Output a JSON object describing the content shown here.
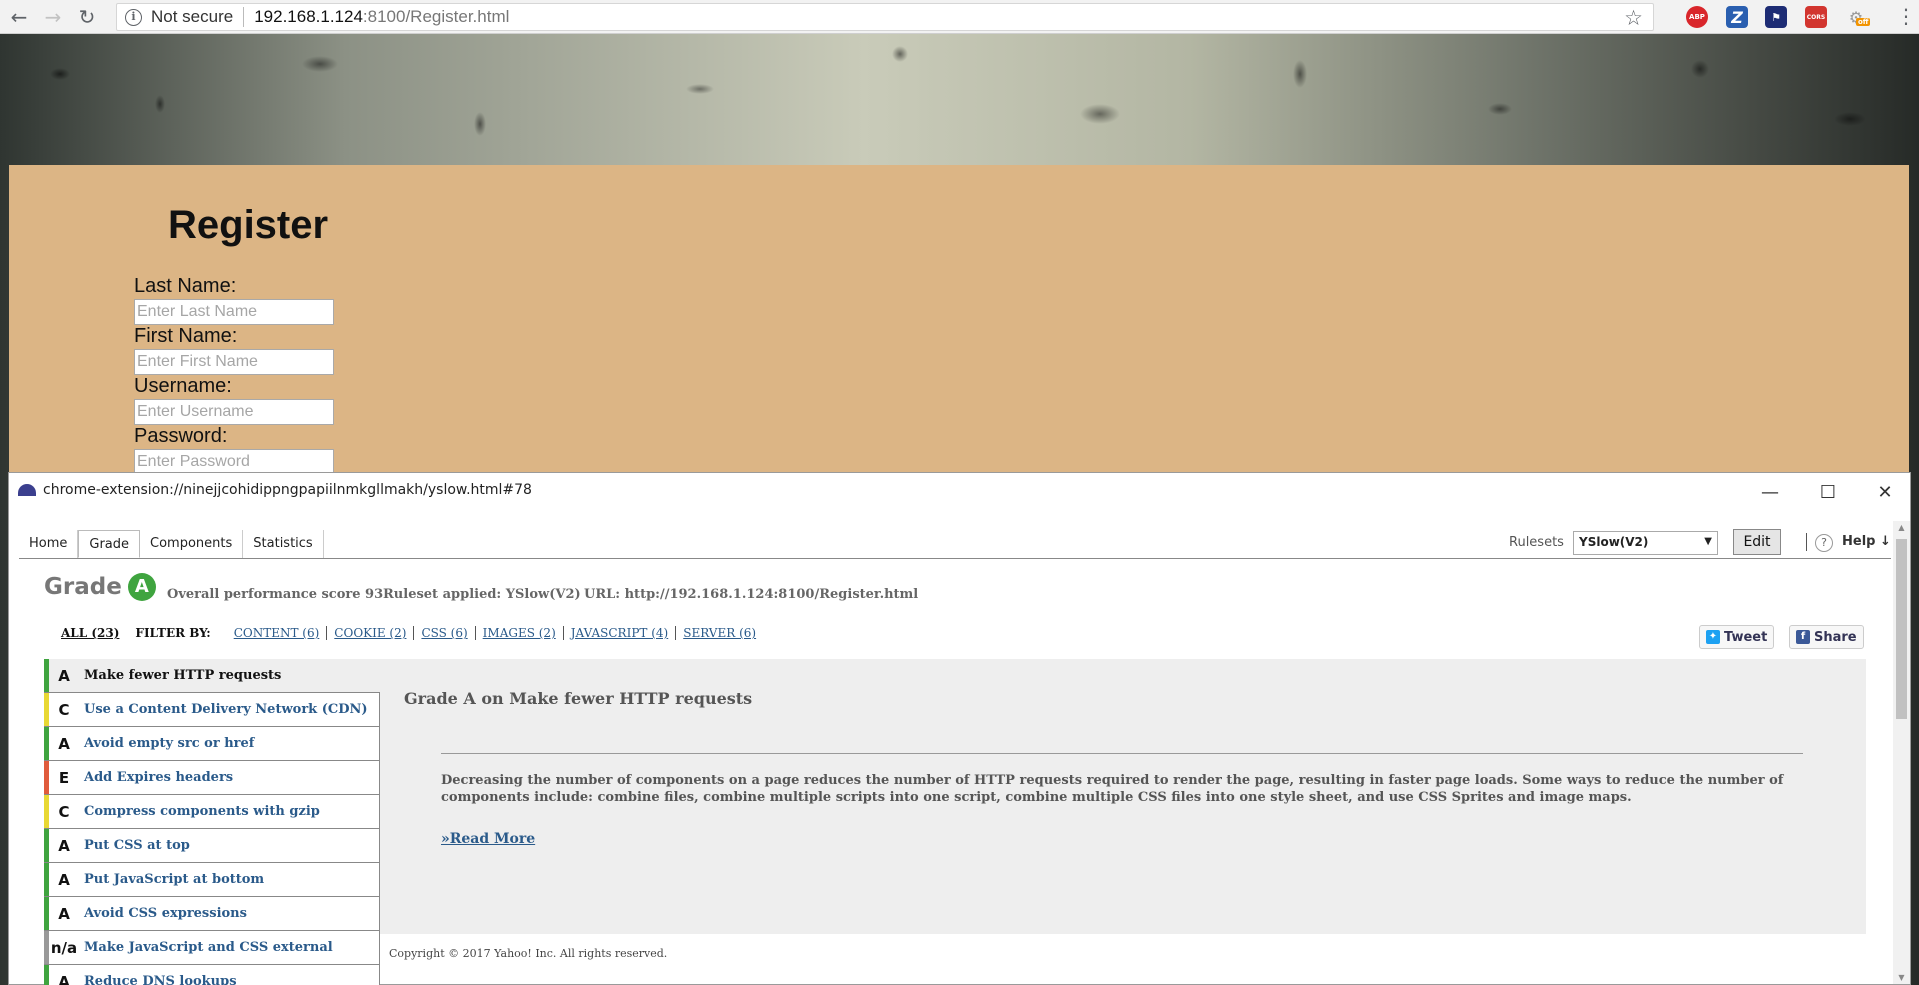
{
  "browser": {
    "security_label": "Not secure",
    "url_host": "192.168.1.124",
    "url_rest": ":8100/Register.html",
    "extensions": [
      "ABP",
      "Z",
      "flag",
      "CORS",
      "off"
    ]
  },
  "register": {
    "title": "Register",
    "fields": [
      {
        "label": "Last Name:",
        "placeholder": "Enter Last Name"
      },
      {
        "label": "First Name:",
        "placeholder": "Enter First Name"
      },
      {
        "label": "Username:",
        "placeholder": "Enter Username"
      },
      {
        "label": "Password:",
        "placeholder": "Enter Password"
      }
    ]
  },
  "yslow": {
    "window_url": "chrome-extension://ninejjcohidippngpapiilnmkgllmakh/yslow.html#78",
    "tabs": [
      "Home",
      "Grade",
      "Components",
      "Statistics"
    ],
    "active_tab": "Grade",
    "rulesets_label": "Rulesets",
    "ruleset_selected": "YSlow(V2)",
    "edit_label": "Edit",
    "help_label": "Help ↓",
    "grade_word": "Grade",
    "grade": "A",
    "score_text": "Overall performance score 93",
    "ruleset_text": "Ruleset applied: YSlow(V2)",
    "url_text": "URL: http://192.168.1.124:8100/Register.html",
    "filter_all": "ALL (23)",
    "filter_by": "FILTER BY:",
    "filters": [
      "CONTENT (6)",
      "COOKIE (2)",
      "CSS (6)",
      "IMAGES (2)",
      "JAVASCRIPT (4)",
      "SERVER (6)"
    ],
    "tweet_label": "Tweet",
    "share_label": "Share",
    "rules": [
      {
        "grade": "A",
        "title": "Make fewer HTTP requests",
        "color": "#3fa43f"
      },
      {
        "grade": "C",
        "title": "Use a Content Delivery Network (CDN)",
        "color": "#e8d834"
      },
      {
        "grade": "A",
        "title": "Avoid empty src or href",
        "color": "#3fa43f"
      },
      {
        "grade": "E",
        "title": "Add Expires headers",
        "color": "#e05b3c"
      },
      {
        "grade": "C",
        "title": "Compress components with gzip",
        "color": "#e8d834"
      },
      {
        "grade": "A",
        "title": "Put CSS at top",
        "color": "#3fa43f"
      },
      {
        "grade": "A",
        "title": "Put JavaScript at bottom",
        "color": "#3fa43f"
      },
      {
        "grade": "A",
        "title": "Avoid CSS expressions",
        "color": "#3fa43f"
      },
      {
        "grade": "n/a",
        "title": "Make JavaScript and CSS external",
        "color": "#999999"
      },
      {
        "grade": "A",
        "title": "Reduce DNS lookups",
        "color": "#3fa43f"
      }
    ],
    "detail_title": "Grade A on Make fewer HTTP requests",
    "detail_text": "Decreasing the number of components on a page reduces the number of HTTP requests required to render the page, resulting in faster page loads. Some ways to reduce the number of components include: combine files, combine multiple scripts into one script, combine multiple CSS files into one style sheet, and use CSS Sprites and image maps.",
    "read_more": "»Read More",
    "copyright": "Copyright © 2017 Yahoo! Inc. All rights reserved."
  }
}
